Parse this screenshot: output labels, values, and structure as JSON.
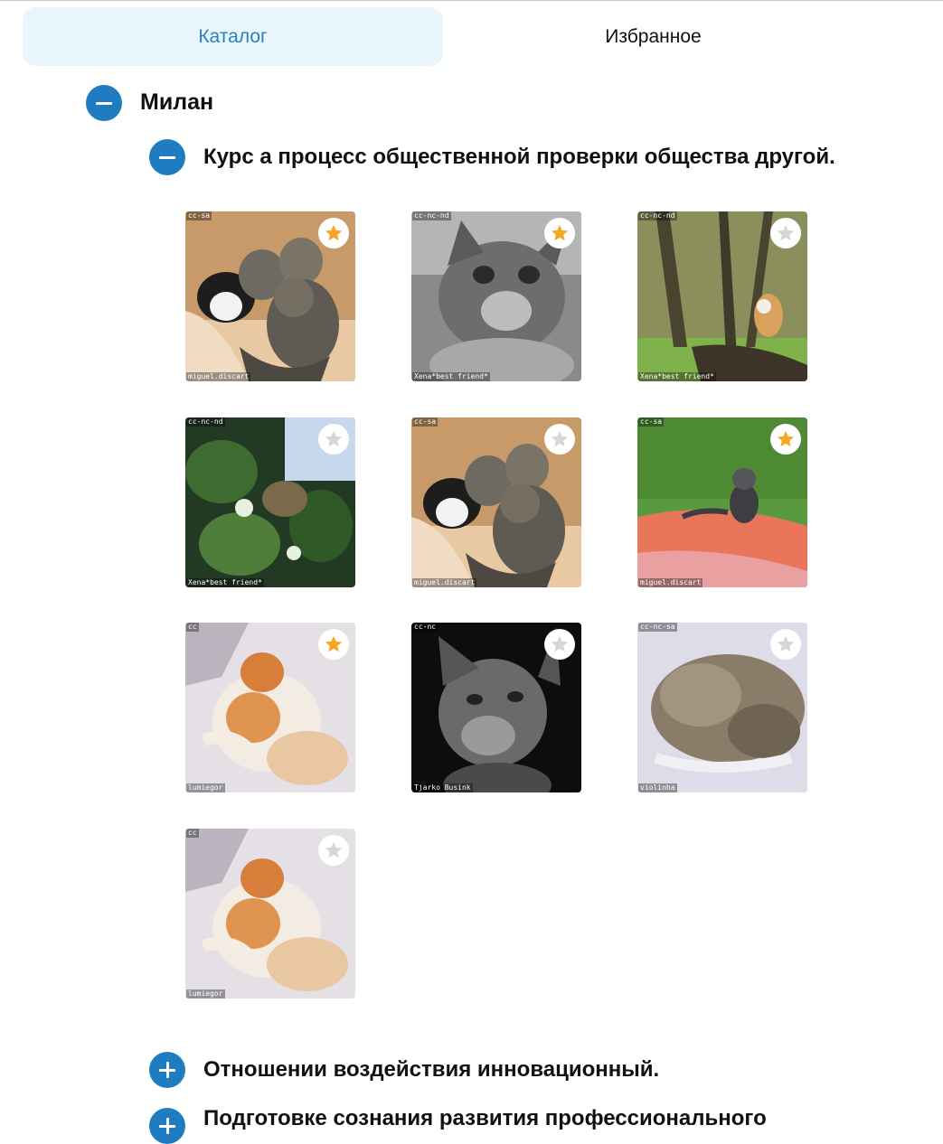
{
  "tabs": [
    {
      "label": "Каталог",
      "active": true
    },
    {
      "label": "Избранное",
      "active": false
    }
  ],
  "colors": {
    "accent": "#1f7cc1",
    "tab_active_bg": "#eaf6fd",
    "tab_active_text": "#2b80ba",
    "star_on": "#f5a623",
    "star_off": "#d6d6d6"
  },
  "category": {
    "title": "Милан",
    "expanded": true,
    "subcategories": [
      {
        "title": "Курс а процесс общественной проверки общества другой.",
        "expanded": true,
        "images": [
          {
            "license": "cc-sa",
            "author": "miguel.discart",
            "favorite": true,
            "icon": "kittens-photo"
          },
          {
            "license": "cc-nc-nd",
            "author": "Xena*best friend*",
            "favorite": true,
            "icon": "grey-cat-photo"
          },
          {
            "license": "cc-nc-nd",
            "author": "Xena*best friend*",
            "favorite": false,
            "icon": "cat-in-tree-photo"
          },
          {
            "license": "cc-nc-nd",
            "author": "Xena*best friend*",
            "favorite": false,
            "icon": "cat-in-foliage-photo"
          },
          {
            "license": "cc-sa",
            "author": "miguel.discart",
            "favorite": false,
            "icon": "kittens-photo"
          },
          {
            "license": "cc-sa",
            "author": "miguel.discart",
            "favorite": true,
            "icon": "tabby-on-wall-photo"
          },
          {
            "license": "cc",
            "author": "lumiegor",
            "favorite": true,
            "icon": "ginger-cat-photo"
          },
          {
            "license": "cc-nc",
            "author": "Tjarko Busink",
            "favorite": false,
            "icon": "bw-cat-photo"
          },
          {
            "license": "cc-nc-sa",
            "author": "violinha",
            "favorite": false,
            "icon": "sleeping-tabby-photo"
          },
          {
            "license": "cc",
            "author": "lumiegor",
            "favorite": false,
            "icon": "ginger-cat-photo"
          }
        ]
      },
      {
        "title": "Отношении воздействия инновационный.",
        "expanded": false
      },
      {
        "title": "Подготовке сознания развития профессионального",
        "expanded": false
      }
    ]
  }
}
